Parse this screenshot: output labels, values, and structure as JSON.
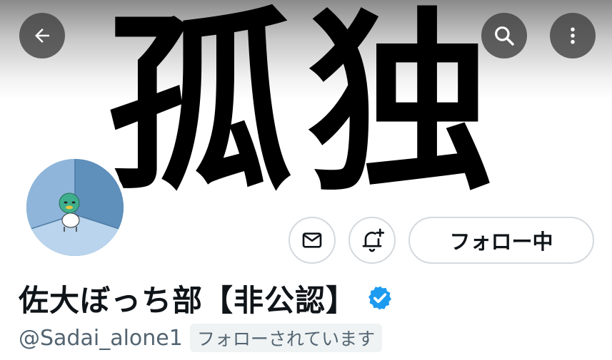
{
  "banner": {
    "text": "孤独"
  },
  "header": {
    "back_icon": "arrow-left-icon",
    "search_icon": "search-icon",
    "more_icon": "more-vertical-icon"
  },
  "profile": {
    "display_name": "佐大ぼっち部【非公認】",
    "handle": "@Sadai_alone1",
    "follows_you": "フォローされています",
    "verified_icon": "verified-badge-icon",
    "verified_color": "#1d9bf0"
  },
  "actions": {
    "message_icon": "mail-icon",
    "notify_icon": "bell-plus-icon",
    "following_label": "フォロー中"
  },
  "colors": {
    "text_primary": "#0f1419",
    "text_secondary": "#536471",
    "border": "#d4d9de",
    "accent": "#1d9bf0"
  }
}
